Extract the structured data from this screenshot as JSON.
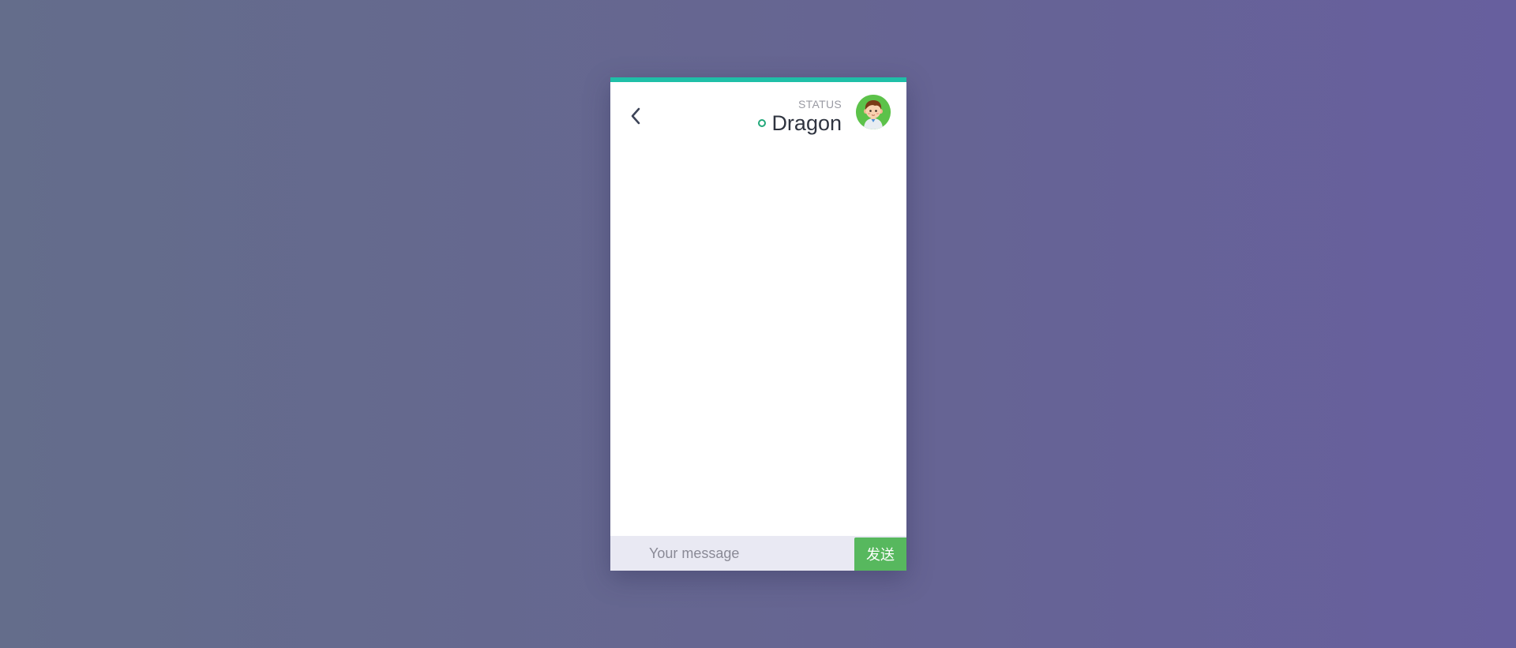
{
  "header": {
    "status_label": "STATUS",
    "user_name": "Dragon",
    "online_color": "#22a87a",
    "accent_color": "#1fbfa8"
  },
  "icons": {
    "back": "chevron-left-icon",
    "online": "online-status-icon",
    "avatar": "boy-avatar"
  },
  "composer": {
    "placeholder": "Your message",
    "value": "",
    "send_label": "发送",
    "send_color": "#57b85e"
  }
}
